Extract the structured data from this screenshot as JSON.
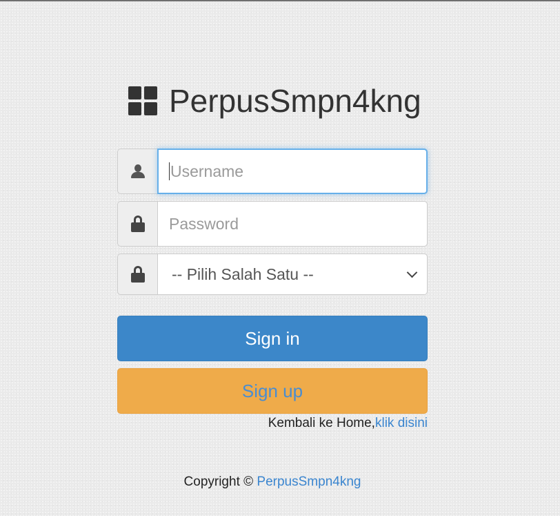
{
  "brand": {
    "logo_icon": "th-large-icon",
    "name": "PerpusSmpn4kng"
  },
  "form": {
    "username": {
      "icon": "user-icon",
      "placeholder": "Username",
      "value": "",
      "focused": true
    },
    "password": {
      "icon": "lock-icon",
      "placeholder": "Password",
      "value": ""
    },
    "role_select": {
      "icon": "lock-icon",
      "selected": "-- Pilih Salah Satu --"
    },
    "signin_label": "Sign in",
    "signup_label": "Sign up",
    "home_text": "Kembali ke Home,",
    "home_link": "klik disini"
  },
  "footer": {
    "copyright_text": "Copyright ©",
    "brand_link": "PerpusSmpn4kng"
  },
  "colors": {
    "primary": "#3c87c9",
    "warning": "#efab4a",
    "link": "#3a85cf",
    "focus_border": "#66afe9",
    "background": "#eaeaea"
  }
}
